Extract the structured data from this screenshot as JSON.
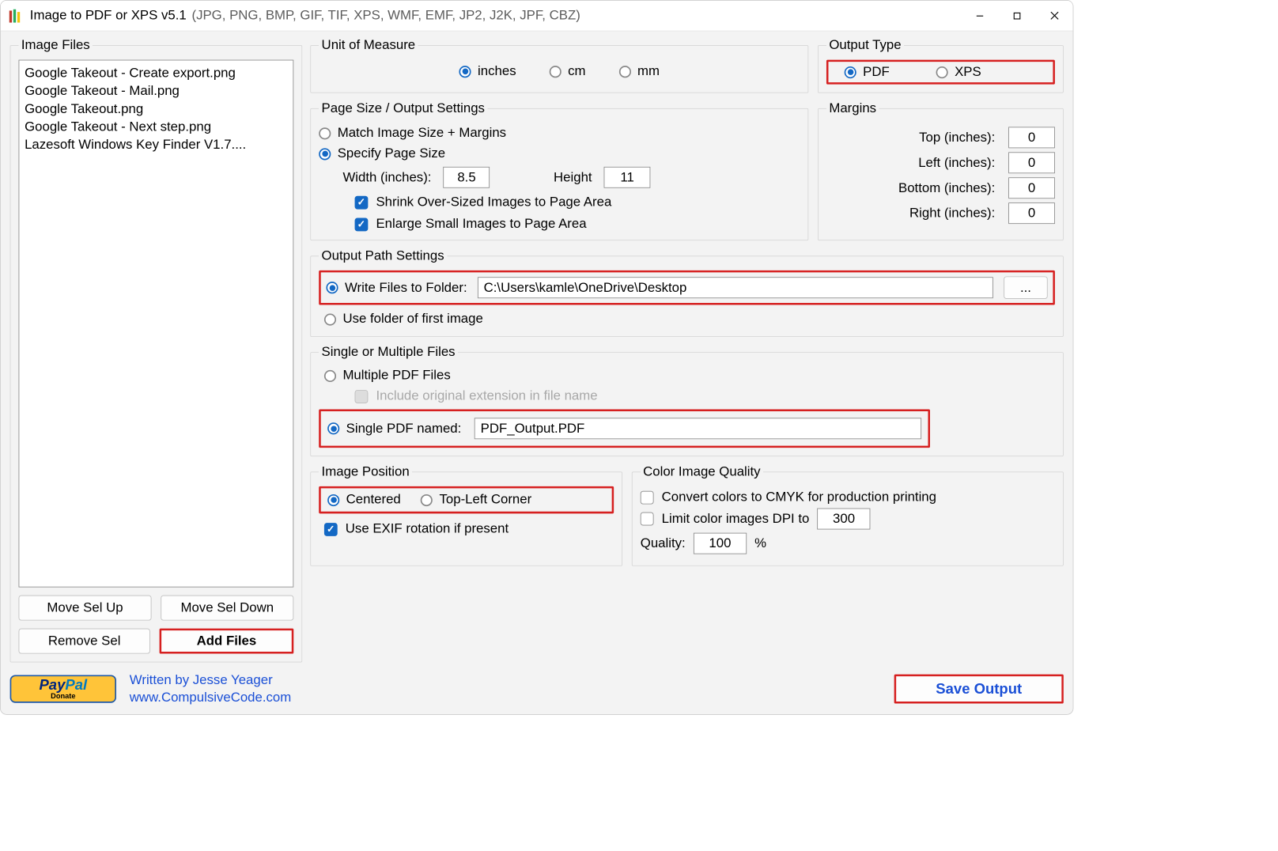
{
  "window": {
    "title": "Image to PDF or XPS  v5.1",
    "subtitle": "(JPG, PNG, BMP, GIF, TIF, XPS, WMF, EMF, JP2, J2K, JPF, CBZ)"
  },
  "image_files": {
    "legend": "Image Files",
    "items": [
      "Google Takeout - Create export.png",
      "Google Takeout - Mail.png",
      "Google Takeout.png",
      "Google Takeout - Next step.png",
      "Lazesoft Windows Key Finder V1.7...."
    ],
    "buttons": {
      "move_up": "Move Sel Up",
      "move_down": "Move Sel Down",
      "remove": "Remove Sel",
      "add": "Add Files"
    }
  },
  "unit_of_measure": {
    "legend": "Unit of Measure",
    "inches": "inches",
    "cm": "cm",
    "mm": "mm"
  },
  "output_type": {
    "legend": "Output Type",
    "pdf": "PDF",
    "xps": "XPS"
  },
  "page_size": {
    "legend": "Page Size / Output Settings",
    "match_label": "Match Image Size + Margins",
    "specify_label": "Specify Page Size",
    "width_label": "Width (inches):",
    "width_value": "8.5",
    "height_label": "Height",
    "height_value": "11",
    "shrink_label": "Shrink Over-Sized Images to Page Area",
    "enlarge_label": "Enlarge Small Images to Page Area"
  },
  "margins": {
    "legend": "Margins",
    "top_label": "Top (inches):",
    "left_label": "Left (inches):",
    "bottom_label": "Bottom (inches):",
    "right_label": "Right (inches):",
    "top": "0",
    "left": "0",
    "bottom": "0",
    "right": "0"
  },
  "output_path": {
    "legend": "Output Path Settings",
    "write_label": "Write Files to Folder:",
    "path": "C:\\Users\\kamle\\OneDrive\\Desktop",
    "browse": "...",
    "use_folder_label": "Use folder of first image"
  },
  "single_multiple": {
    "legend": "Single or Multiple Files",
    "multiple_label": "Multiple PDF Files",
    "include_ext_label": "Include original extension in file name",
    "single_label": "Single PDF named:",
    "single_name": "PDF_Output.PDF"
  },
  "image_position": {
    "legend": "Image Position",
    "centered": "Centered",
    "topleft": "Top-Left Corner",
    "exif_label": "Use EXIF rotation if present"
  },
  "color_quality": {
    "legend": "Color Image Quality",
    "cmyk_label": "Convert colors to CMYK for production printing",
    "limit_dpi_label": "Limit color images DPI to",
    "dpi_value": "300",
    "quality_label": "Quality:",
    "quality_value": "100",
    "percent": "%"
  },
  "footer": {
    "paypal_sub": "Donate",
    "credits_1": "Written by Jesse Yeager",
    "credits_2": "www.CompulsiveCode.com",
    "save": "Save Output"
  }
}
